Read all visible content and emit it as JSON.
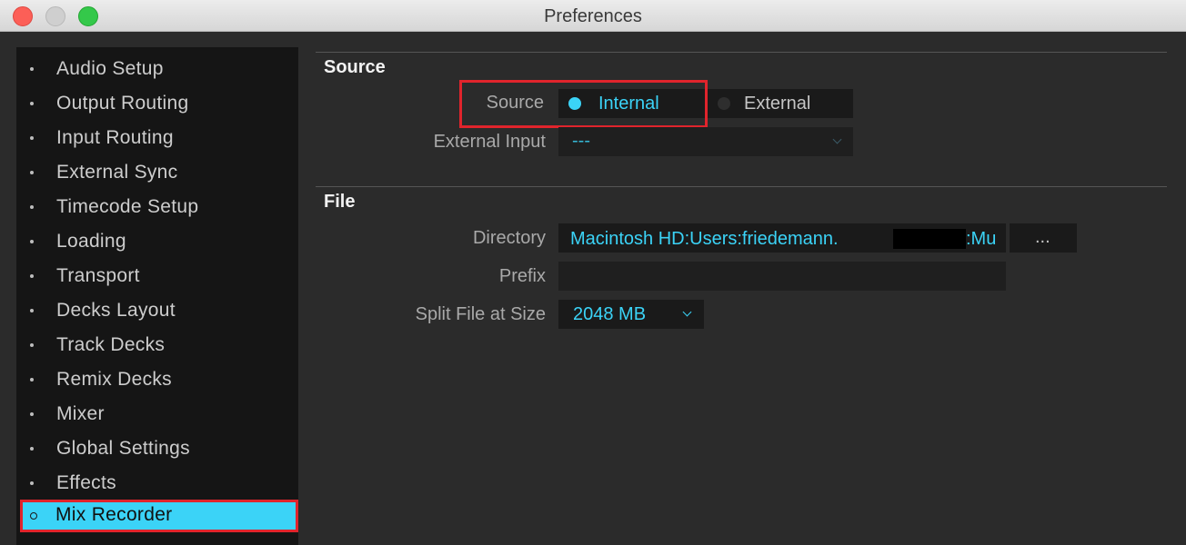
{
  "window": {
    "title": "Preferences"
  },
  "sidebar": {
    "items": [
      {
        "label": "Audio Setup"
      },
      {
        "label": "Output Routing"
      },
      {
        "label": "Input Routing"
      },
      {
        "label": "External Sync"
      },
      {
        "label": "Timecode Setup"
      },
      {
        "label": "Loading"
      },
      {
        "label": "Transport"
      },
      {
        "label": "Decks Layout"
      },
      {
        "label": "Track Decks"
      },
      {
        "label": "Remix Decks"
      },
      {
        "label": "Mixer"
      },
      {
        "label": "Global Settings"
      },
      {
        "label": "Effects"
      },
      {
        "label": "Mix Recorder",
        "selected": true
      }
    ]
  },
  "source_section": {
    "title": "Source",
    "source_label": "Source",
    "option_internal": "Internal",
    "option_external": "External",
    "selected": "Internal",
    "external_input_label": "External Input",
    "external_input_value": "---"
  },
  "file_section": {
    "title": "File",
    "directory_label": "Directory",
    "directory_value": "Macintosh HD:Users:friedemann.",
    "directory_value_tail": ":Mu",
    "browse_label": "...",
    "prefix_label": "Prefix",
    "prefix_value": "",
    "split_label": "Split File at Size",
    "split_value": "2048 MB"
  },
  "colors": {
    "accent": "#3bd3f7",
    "highlight_border": "#e0242c",
    "panel_bg": "#2b2b2b",
    "sidebar_bg": "#151515"
  }
}
